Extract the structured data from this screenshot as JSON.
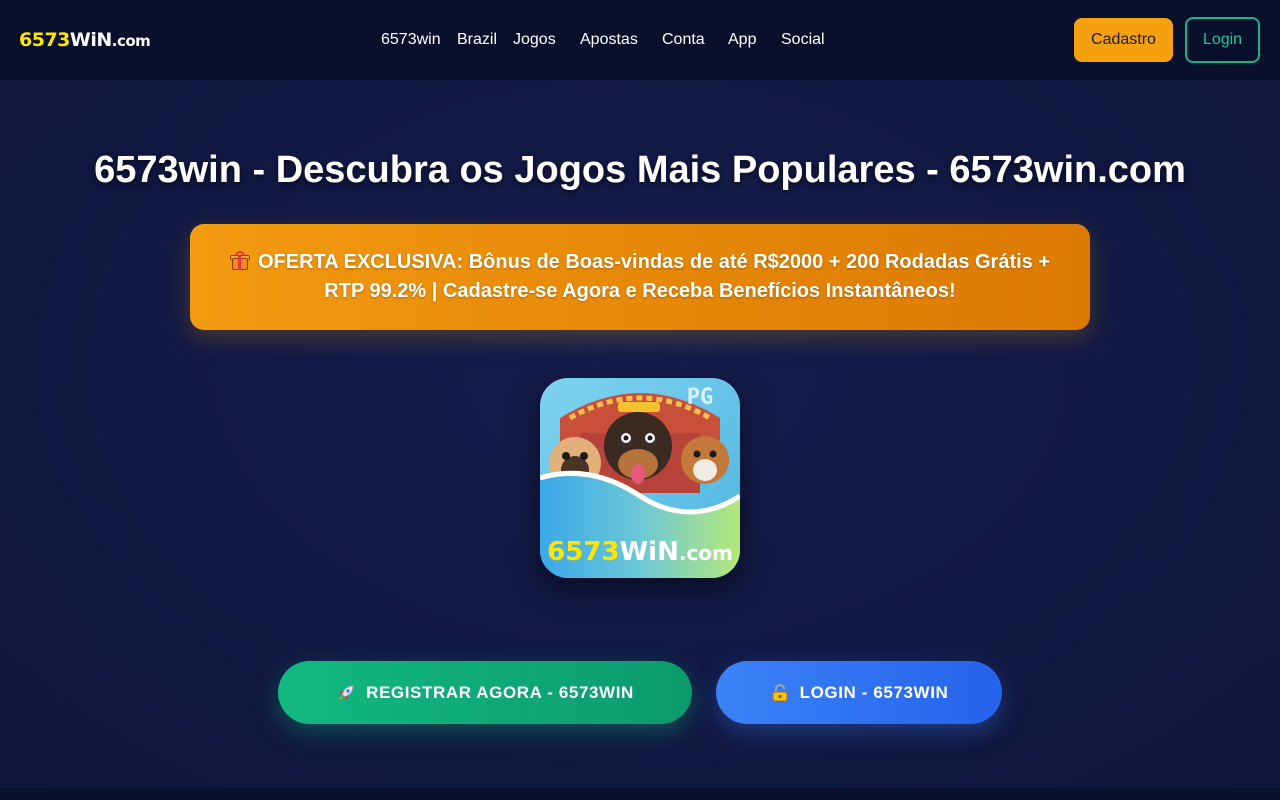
{
  "header": {
    "logo": {
      "number": "6573",
      "brand": "WiN",
      "tld": ".com"
    },
    "nav": [
      {
        "label": "6573win"
      },
      {
        "label": "Brazil"
      },
      {
        "label": "Jogos"
      },
      {
        "label": "Apostas"
      },
      {
        "label": "Conta"
      },
      {
        "label": "App"
      },
      {
        "label": "Social"
      }
    ],
    "cadastro_label": "Cadastro",
    "login_label": "Login"
  },
  "main": {
    "title": "6573win - Descubra os Jogos Mais Populares - 6573win.com",
    "promo": {
      "icon": "gift-icon",
      "text": "OFERTA EXCLUSIVA: Bônus de Boas-vindas de até R$2000 + 200 Rodadas Grátis + RTP 99.2% | Cadastre-se Agora e Receba Benefícios Instantâneos!"
    },
    "game_image": {
      "badge": "PG",
      "logo_number": "6573",
      "logo_brand": "WiN",
      "logo_tld": ".com"
    },
    "register_button": {
      "icon": "rocket-icon",
      "label": "REGISTRAR AGORA - 6573WIN"
    },
    "login_button": {
      "icon": "lock-icon",
      "label": "LOGIN - 6573WIN"
    }
  },
  "colors": {
    "background": "#0d1433",
    "header": "#0a0f2c",
    "logo_yellow": "#ffe600",
    "cadastro": "#f5a00f",
    "login_border": "#13b58a",
    "promo": "#e58708",
    "register": "#12b981",
    "login": "#3b82f6"
  }
}
